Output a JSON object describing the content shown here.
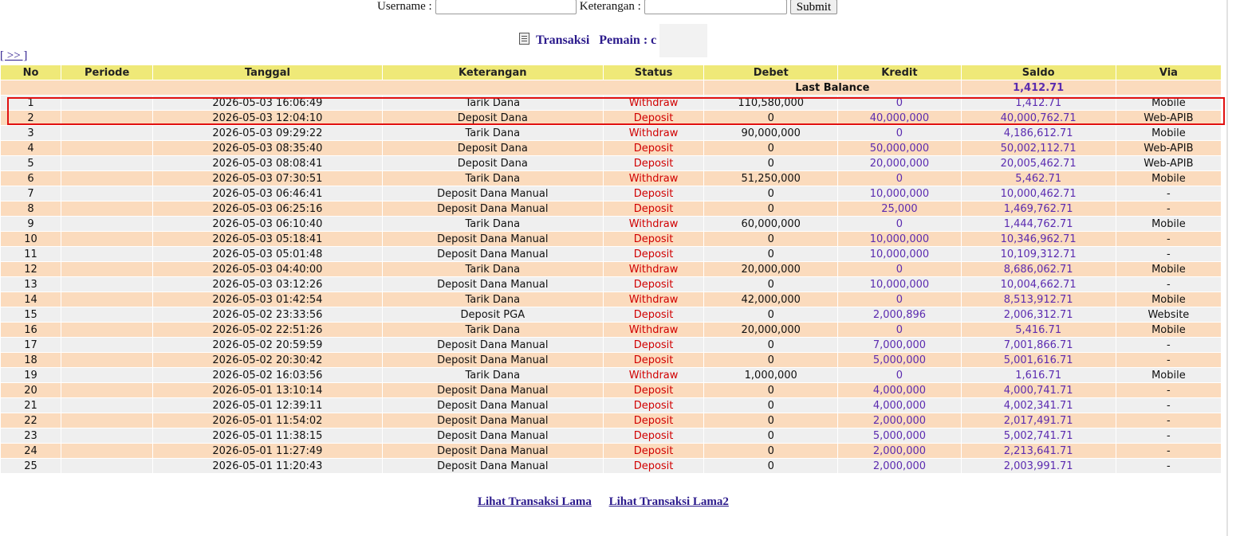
{
  "filter": {
    "username_label": "Username :",
    "username_value": "",
    "keterangan_label": "Keterangan :",
    "keterangan_value": "",
    "submit_label": "Submit"
  },
  "heading": {
    "title": "Transaksi",
    "pemain_label": "Pemain : c"
  },
  "nav": {
    "next_label": "[ >> ]"
  },
  "table": {
    "headers": [
      "No",
      "Periode",
      "Tanggal",
      "Keterangan",
      "Status",
      "Debet",
      "Kredit",
      "Saldo",
      "Via"
    ],
    "last_balance_label": "Last Balance",
    "last_balance_value": "1,412.71",
    "rows": [
      {
        "no": "1",
        "periode": "",
        "tanggal": "2026-05-03 16:06:49",
        "keterangan": "Tarik Dana",
        "status": "Withdraw",
        "debet": "110,580,000",
        "kredit": "0",
        "saldo": "1,412.71",
        "via": "Mobile"
      },
      {
        "no": "2",
        "periode": "",
        "tanggal": "2026-05-03 12:04:10",
        "keterangan": "Deposit Dana",
        "status": "Deposit",
        "debet": "0",
        "kredit": "40,000,000",
        "saldo": "40,000,762.71",
        "via": "Web-APIB"
      },
      {
        "no": "3",
        "periode": "",
        "tanggal": "2026-05-03 09:29:22",
        "keterangan": "Tarik Dana",
        "status": "Withdraw",
        "debet": "90,000,000",
        "kredit": "0",
        "saldo": "4,186,612.71",
        "via": "Mobile"
      },
      {
        "no": "4",
        "periode": "",
        "tanggal": "2026-05-03 08:35:40",
        "keterangan": "Deposit Dana",
        "status": "Deposit",
        "debet": "0",
        "kredit": "50,000,000",
        "saldo": "50,002,112.71",
        "via": "Web-APIB"
      },
      {
        "no": "5",
        "periode": "",
        "tanggal": "2026-05-03 08:08:41",
        "keterangan": "Deposit Dana",
        "status": "Deposit",
        "debet": "0",
        "kredit": "20,000,000",
        "saldo": "20,005,462.71",
        "via": "Web-APIB"
      },
      {
        "no": "6",
        "periode": "",
        "tanggal": "2026-05-03 07:30:51",
        "keterangan": "Tarik Dana",
        "status": "Withdraw",
        "debet": "51,250,000",
        "kredit": "0",
        "saldo": "5,462.71",
        "via": "Mobile"
      },
      {
        "no": "7",
        "periode": "",
        "tanggal": "2026-05-03 06:46:41",
        "keterangan": "Deposit Dana Manual",
        "status": "Deposit",
        "debet": "0",
        "kredit": "10,000,000",
        "saldo": "10,000,462.71",
        "via": "-"
      },
      {
        "no": "8",
        "periode": "",
        "tanggal": "2026-05-03 06:25:16",
        "keterangan": "Deposit Dana Manual",
        "status": "Deposit",
        "debet": "0",
        "kredit": "25,000",
        "saldo": "1,469,762.71",
        "via": "-"
      },
      {
        "no": "9",
        "periode": "",
        "tanggal": "2026-05-03 06:10:40",
        "keterangan": "Tarik Dana",
        "status": "Withdraw",
        "debet": "60,000,000",
        "kredit": "0",
        "saldo": "1,444,762.71",
        "via": "Mobile"
      },
      {
        "no": "10",
        "periode": "",
        "tanggal": "2026-05-03 05:18:41",
        "keterangan": "Deposit Dana Manual",
        "status": "Deposit",
        "debet": "0",
        "kredit": "10,000,000",
        "saldo": "10,346,962.71",
        "via": "-"
      },
      {
        "no": "11",
        "periode": "",
        "tanggal": "2026-05-03 05:01:48",
        "keterangan": "Deposit Dana Manual",
        "status": "Deposit",
        "debet": "0",
        "kredit": "10,000,000",
        "saldo": "10,109,312.71",
        "via": "-"
      },
      {
        "no": "12",
        "periode": "",
        "tanggal": "2026-05-03 04:40:00",
        "keterangan": "Tarik Dana",
        "status": "Withdraw",
        "debet": "20,000,000",
        "kredit": "0",
        "saldo": "8,686,062.71",
        "via": "Mobile"
      },
      {
        "no": "13",
        "periode": "",
        "tanggal": "2026-05-03 03:12:26",
        "keterangan": "Deposit Dana Manual",
        "status": "Deposit",
        "debet": "0",
        "kredit": "10,000,000",
        "saldo": "10,004,662.71",
        "via": "-"
      },
      {
        "no": "14",
        "periode": "",
        "tanggal": "2026-05-03 01:42:54",
        "keterangan": "Tarik Dana",
        "status": "Withdraw",
        "debet": "42,000,000",
        "kredit": "0",
        "saldo": "8,513,912.71",
        "via": "Mobile"
      },
      {
        "no": "15",
        "periode": "",
        "tanggal": "2026-05-02 23:33:56",
        "keterangan": "Deposit PGA",
        "status": "Deposit",
        "debet": "0",
        "kredit": "2,000,896",
        "saldo": "2,006,312.71",
        "via": "Website"
      },
      {
        "no": "16",
        "periode": "",
        "tanggal": "2026-05-02 22:51:26",
        "keterangan": "Tarik Dana",
        "status": "Withdraw",
        "debet": "20,000,000",
        "kredit": "0",
        "saldo": "5,416.71",
        "via": "Mobile"
      },
      {
        "no": "17",
        "periode": "",
        "tanggal": "2026-05-02 20:59:59",
        "keterangan": "Deposit Dana Manual",
        "status": "Deposit",
        "debet": "0",
        "kredit": "7,000,000",
        "saldo": "7,001,866.71",
        "via": "-"
      },
      {
        "no": "18",
        "periode": "",
        "tanggal": "2026-05-02 20:30:42",
        "keterangan": "Deposit Dana Manual",
        "status": "Deposit",
        "debet": "0",
        "kredit": "5,000,000",
        "saldo": "5,001,616.71",
        "via": "-"
      },
      {
        "no": "19",
        "periode": "",
        "tanggal": "2026-05-02 16:03:56",
        "keterangan": "Tarik Dana",
        "status": "Withdraw",
        "debet": "1,000,000",
        "kredit": "0",
        "saldo": "1,616.71",
        "via": "Mobile"
      },
      {
        "no": "20",
        "periode": "",
        "tanggal": "2026-05-01 13:10:14",
        "keterangan": "Deposit Dana Manual",
        "status": "Deposit",
        "debet": "0",
        "kredit": "4,000,000",
        "saldo": "4,000,741.71",
        "via": "-"
      },
      {
        "no": "21",
        "periode": "",
        "tanggal": "2026-05-01 12:39:11",
        "keterangan": "Deposit Dana Manual",
        "status": "Deposit",
        "debet": "0",
        "kredit": "4,000,000",
        "saldo": "4,002,341.71",
        "via": "-"
      },
      {
        "no": "22",
        "periode": "",
        "tanggal": "2026-05-01 11:54:02",
        "keterangan": "Deposit Dana Manual",
        "status": "Deposit",
        "debet": "0",
        "kredit": "2,000,000",
        "saldo": "2,017,491.71",
        "via": "-"
      },
      {
        "no": "23",
        "periode": "",
        "tanggal": "2026-05-01 11:38:15",
        "keterangan": "Deposit Dana Manual",
        "status": "Deposit",
        "debet": "0",
        "kredit": "5,000,000",
        "saldo": "5,002,741.71",
        "via": "-"
      },
      {
        "no": "24",
        "periode": "",
        "tanggal": "2026-05-01 11:27:49",
        "keterangan": "Deposit Dana Manual",
        "status": "Deposit",
        "debet": "0",
        "kredit": "2,000,000",
        "saldo": "2,213,641.71",
        "via": "-"
      },
      {
        "no": "25",
        "periode": "",
        "tanggal": "2026-05-01 11:20:43",
        "keterangan": "Deposit Dana Manual",
        "status": "Deposit",
        "debet": "0",
        "kredit": "2,000,000",
        "saldo": "2,003,991.71",
        "via": "-"
      }
    ]
  },
  "footer": {
    "link1": "Lihat Transaksi Lama",
    "link2": "Lihat Transaksi Lama2"
  },
  "colors": {
    "header_bg": "#efe978",
    "row_even": "#efefef",
    "row_odd": "#fbdbbd",
    "status_red": "#d10000",
    "amount_purple": "#5b2bb0",
    "link_blue": "#2b1a8c",
    "highlight_red": "#e11010"
  },
  "icons": {
    "heading_icon": "clipboard-icon"
  }
}
